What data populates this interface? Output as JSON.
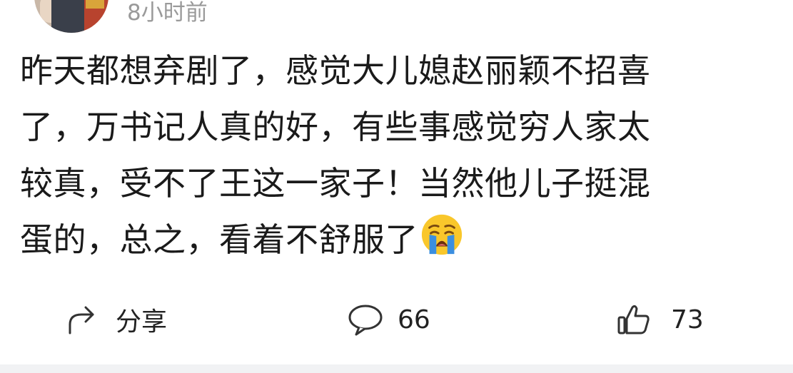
{
  "comment": {
    "timestamp": "8小时前",
    "lines": [
      "昨天都想弃剧了，感觉大儿媳赵丽颖不招喜",
      "了，万书记人真的好，有些事感觉穷人家太",
      "较真，受不了王这一家子！当然他儿子挺混",
      "蛋的，总之，看着不舒服了"
    ],
    "emoji": "loudly-crying-face"
  },
  "actions": {
    "share_label": "分享",
    "comment_count": "66",
    "like_count": "73"
  },
  "icons": {
    "share": "share-arrow-icon",
    "comment": "comment-bubble-icon",
    "like": "thumbs-up-icon"
  },
  "colors": {
    "text": "#1a1a1a",
    "meta": "#9a9a9a",
    "icon": "#333333",
    "divider": "#f1f2f4"
  }
}
